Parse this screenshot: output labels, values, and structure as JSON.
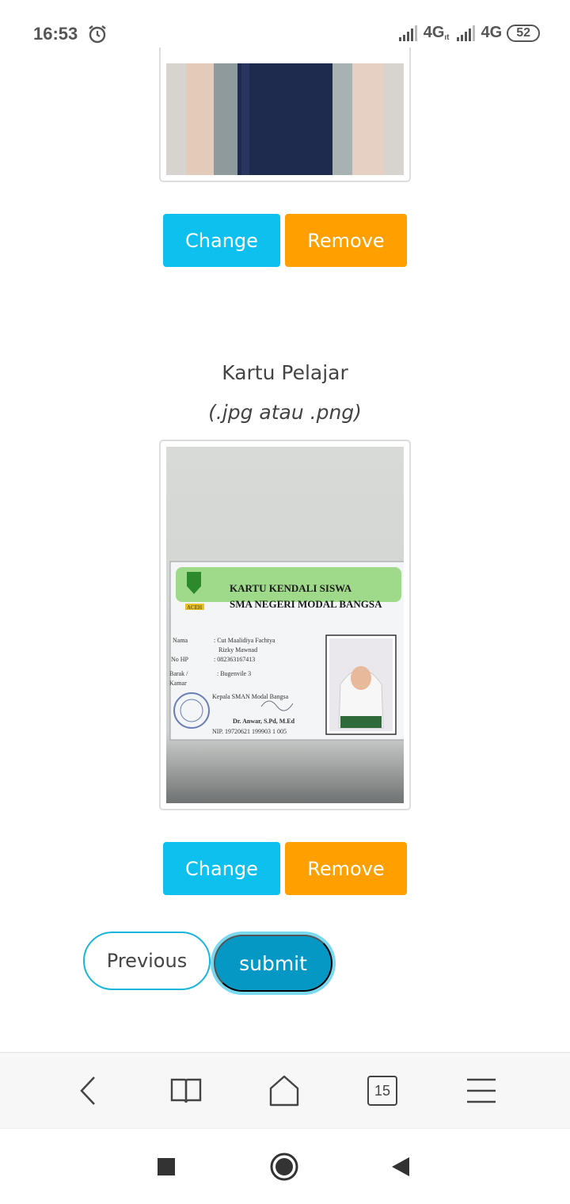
{
  "status_bar": {
    "time": "16:53",
    "network1": "4G",
    "network1_sub": "ıt",
    "network2": "4G",
    "battery": "52"
  },
  "upload1": {
    "change_label": "Change",
    "remove_label": "Remove"
  },
  "upload2": {
    "title": "Kartu Pelajar",
    "subtitle": "(.jpg atau .png)",
    "change_label": "Change",
    "remove_label": "Remove",
    "card": {
      "heading1": "KARTU KENDALI SISWA",
      "heading2": "SMA NEGERI MODAL BANGSA",
      "logo_text": "ACEH",
      "label_nama": "Nama",
      "value_nama": ": Cut Maalidiya Fachtya",
      "value_nama2": "Rizky Mawnad",
      "label_hp": "No HP",
      "value_hp": ": 082363167413",
      "label_barak": "Barak /",
      "label_kamar": "Kamar",
      "value_barak": ": Bugenvile 3",
      "kepala": "Kepala SMAN Modal Bangsa",
      "signer": "Dr. Anwar, S.Pd, M.Ed",
      "nip": "NIP. 19720621 199903 1 005"
    }
  },
  "form_nav": {
    "previous_label": "Previous",
    "submit_label": "submit"
  },
  "browser_bar": {
    "tab_count": "15"
  },
  "colors": {
    "change": "#0dc0ee",
    "remove": "#ff9f00",
    "submit": "#0598c4"
  }
}
